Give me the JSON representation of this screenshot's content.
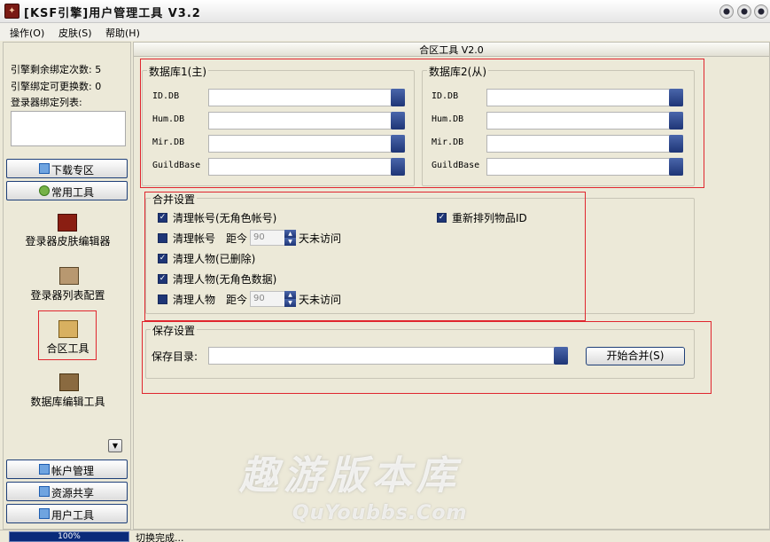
{
  "window": {
    "title": "[KSF引擎]用户管理工具 V3.2"
  },
  "menu": {
    "items": [
      "操作(O)",
      "皮肤(S)",
      "帮助(H)"
    ]
  },
  "left": {
    "stats": [
      "引擎剩余绑定次数: 5",
      "引擎绑定可更换数: 0",
      "登录器绑定列表:"
    ],
    "nav_top": [
      "下载专区",
      "常用工具"
    ],
    "tools": [
      "登录器皮肤编辑器",
      "登录器列表配置",
      "合区工具",
      "数据库编辑工具"
    ],
    "nav_bottom": [
      "帐户管理",
      "资源共享",
      "用户工具"
    ]
  },
  "right": {
    "header": "合区工具 V2.0",
    "db1": {
      "title": "数据库1(主)",
      "rows": [
        "ID.DB",
        "Hum.DB",
        "Mir.DB",
        "GuildBase"
      ]
    },
    "db2": {
      "title": "数据库2(从)",
      "rows": [
        "ID.DB",
        "Hum.DB",
        "Mir.DB",
        "GuildBase"
      ]
    },
    "merge": {
      "title": "合并设置",
      "opt1": "清理帐号(无角色帐号)",
      "opt2": "清理帐号",
      "opt3": "清理人物(已删除)",
      "opt4": "清理人物(无角色数据)",
      "opt5": "清理人物",
      "opt6": "重新排列物品ID",
      "distance": "距今",
      "days_value": "90",
      "days_suffix": "天未访问"
    },
    "save": {
      "title": "保存设置",
      "dir_label": "保存目录:",
      "dir_value": "",
      "start": "开始合并(S)"
    }
  },
  "status": {
    "progress": "100%",
    "progress_value": 1.0,
    "text": "切换完成..."
  },
  "watermark": {
    "main": "趣游版本库",
    "sub": "QuYoubbs.Com"
  },
  "colors": {
    "accent": "#1e3576",
    "highlight_border": "#e0262e"
  }
}
